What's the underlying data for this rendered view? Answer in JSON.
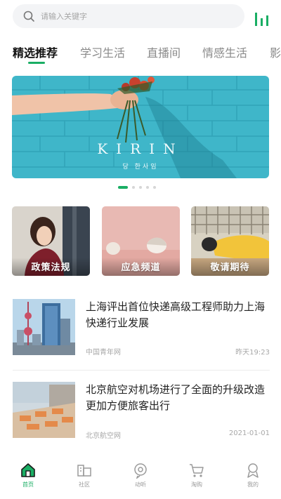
{
  "search": {
    "placeholder": "请输入关键字"
  },
  "tabs": [
    {
      "label": "精选推荐",
      "active": true
    },
    {
      "label": "学习生活"
    },
    {
      "label": "直播间"
    },
    {
      "label": "情感生活"
    },
    {
      "label": "影"
    }
  ],
  "banner": {
    "title": "KIRIN",
    "subtitle": "당 한사임",
    "page_count": 5,
    "current_page": 1
  },
  "categories": [
    {
      "label": "政策法规"
    },
    {
      "label": "应急频道"
    },
    {
      "label": "敬请期待"
    }
  ],
  "news": [
    {
      "title": "上海评出首位快递高级工程师助力上海快递行业发展",
      "source": "中国青年网",
      "time": "昨天19:23"
    },
    {
      "title": "北京航空对机场进行了全面的升级改造更加方便旅客出行",
      "source": "北京航空网",
      "time": "2021-01-01"
    }
  ],
  "bottom_nav": [
    {
      "label": "首页",
      "icon": "home-icon",
      "active": true
    },
    {
      "label": "社区",
      "icon": "community-icon"
    },
    {
      "label": "动听",
      "icon": "listen-icon"
    },
    {
      "label": "淘购",
      "icon": "cart-icon"
    },
    {
      "label": "我的",
      "icon": "profile-icon"
    }
  ],
  "colors": {
    "accent": "#1aae64",
    "muted": "#a8a8a8"
  }
}
